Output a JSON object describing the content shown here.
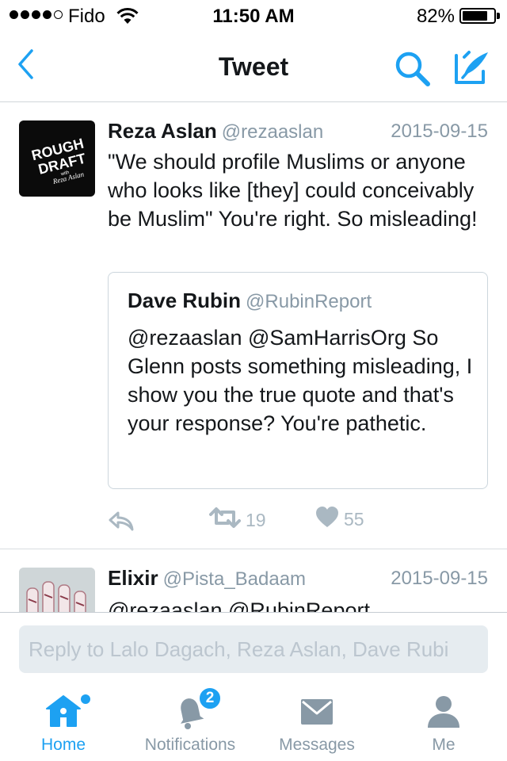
{
  "status_bar": {
    "carrier": "Fido",
    "time": "11:50 AM",
    "battery_percent": "82%",
    "battery_level": 0.82,
    "signal_bars_filled": 4,
    "signal_bars_total": 5
  },
  "nav": {
    "title": "Tweet",
    "back_icon": "chevron-left-icon",
    "search_icon": "search-icon",
    "compose_icon": "compose-icon"
  },
  "tweet": {
    "display_name": "Reza Aslan",
    "handle": "@rezaaslan",
    "date": "2015-09-15",
    "text": "\"We should profile Muslims or anyone who looks like [they] could conceivably be Muslim\" You're right. So misleading!",
    "avatar": {
      "line1": "ROUGH",
      "line2": "DRAFT",
      "line3": "with",
      "line4": "Reza Aslan"
    },
    "quote": {
      "display_name": "Dave Rubin",
      "handle": "@RubinReport",
      "text": "@rezaaslan @SamHarrisOrg So Glenn posts something misleading, I show you the true quote and that's your response? You're pathetic."
    },
    "actions": {
      "retweet_count": "19",
      "like_count": "55"
    }
  },
  "tweet2": {
    "display_name": "Elixir",
    "handle": "@Pista_Badaam",
    "date": "2015-09-15",
    "text": "@rezaaslan @RubinReport"
  },
  "reply": {
    "placeholder": "Reply to Lalo Dagach, Reza Aslan, Dave Rubi"
  },
  "tabs": [
    {
      "label": "Home",
      "icon": "home-icon",
      "active": true
    },
    {
      "label": "Notifications",
      "icon": "bell-icon",
      "badge": "2"
    },
    {
      "label": "Messages",
      "icon": "envelope-icon"
    },
    {
      "label": "Me",
      "icon": "person-icon"
    }
  ],
  "colors": {
    "accent": "#1da1f2",
    "secondary_text": "#8899a6",
    "action_icon": "#aab8c2"
  }
}
